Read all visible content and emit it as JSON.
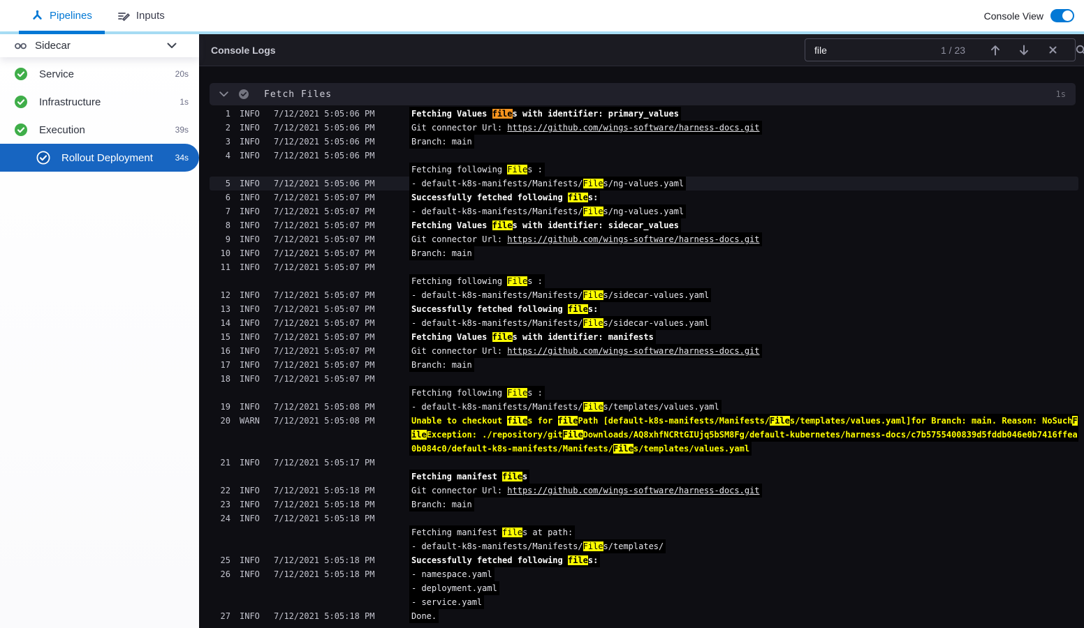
{
  "topbar": {
    "tabs": [
      {
        "label": "Pipelines",
        "active": true
      },
      {
        "label": "Inputs",
        "active": false
      }
    ],
    "console_view_label": "Console View",
    "console_view_on": true
  },
  "sidebar": {
    "pipeline": {
      "name": "Sidecar"
    },
    "steps": [
      {
        "label": "Service",
        "duration": "20s",
        "status": "success",
        "selected": false,
        "indent": 0
      },
      {
        "label": "Infrastructure",
        "duration": "1s",
        "status": "success",
        "selected": false,
        "indent": 0
      },
      {
        "label": "Execution",
        "duration": "39s",
        "status": "success",
        "selected": false,
        "indent": 0
      },
      {
        "label": "Rollout Deployment",
        "duration": "34s",
        "status": "success",
        "selected": true,
        "indent": 1
      }
    ]
  },
  "console": {
    "title": "Console Logs",
    "search": {
      "value": "file",
      "match_counter": "1 / 23"
    },
    "section": {
      "title": "Fetch Files",
      "duration": "1s",
      "status": "success"
    },
    "colors": {
      "accent_blue": "#0278d5",
      "selected_step_blue": "#1765c1",
      "success_green": "#3fae49",
      "highlight_yellow": "#ffff00",
      "highlight_current_orange": "#f7941e",
      "warn_text_yellow": "#ffff00",
      "cyan_strip": "#a8def5"
    },
    "log_lines": [
      {
        "num": 1,
        "level": "INFO",
        "time": "7/12/2021 5:05:06 PM",
        "style": "bold",
        "rows": [
          [
            {
              "t": "Fetching Values "
            },
            {
              "t": "file",
              "h": "current"
            },
            {
              "t": "s with identifier: primary_values"
            }
          ]
        ]
      },
      {
        "num": 2,
        "level": "INFO",
        "time": "7/12/2021 5:05:06 PM",
        "style": "plain",
        "rows": [
          [
            {
              "t": "Git connector Url: "
            },
            {
              "t": "https://github.com/wings-software/harness-docs.git",
              "url": true
            }
          ]
        ]
      },
      {
        "num": 3,
        "level": "INFO",
        "time": "7/12/2021 5:05:06 PM",
        "style": "plain",
        "rows": [
          [
            {
              "t": "Branch: main"
            }
          ]
        ]
      },
      {
        "num": 4,
        "level": "INFO",
        "time": "7/12/2021 5:05:06 PM",
        "style": "plain",
        "rows": [
          [],
          [
            {
              "t": "Fetching following "
            },
            {
              "t": "File",
              "h": "match"
            },
            {
              "t": "s :"
            }
          ]
        ]
      },
      {
        "num": 5,
        "level": "INFO",
        "time": "7/12/2021 5:05:06 PM",
        "style": "plain",
        "current_row": true,
        "rows": [
          [
            {
              "t": "- default-k8s-manifests/Manifests/"
            },
            {
              "t": "File",
              "h": "match"
            },
            {
              "t": "s/ng-values.yaml"
            }
          ]
        ]
      },
      {
        "num": 6,
        "level": "INFO",
        "time": "7/12/2021 5:05:07 PM",
        "style": "bold",
        "rows": [
          [
            {
              "t": "Successfully fetched following "
            },
            {
              "t": "file",
              "h": "match"
            },
            {
              "t": "s:"
            }
          ]
        ]
      },
      {
        "num": 7,
        "level": "INFO",
        "time": "7/12/2021 5:05:07 PM",
        "style": "plain",
        "rows": [
          [
            {
              "t": "- default-k8s-manifests/Manifests/"
            },
            {
              "t": "File",
              "h": "match"
            },
            {
              "t": "s/ng-values.yaml"
            }
          ]
        ]
      },
      {
        "num": 8,
        "level": "INFO",
        "time": "7/12/2021 5:05:07 PM",
        "style": "bold",
        "rows": [
          [
            {
              "t": "Fetching Values "
            },
            {
              "t": "file",
              "h": "match"
            },
            {
              "t": "s with identifier: sidecar_values"
            }
          ]
        ]
      },
      {
        "num": 9,
        "level": "INFO",
        "time": "7/12/2021 5:05:07 PM",
        "style": "plain",
        "rows": [
          [
            {
              "t": "Git connector Url: "
            },
            {
              "t": "https://github.com/wings-software/harness-docs.git",
              "url": true
            }
          ]
        ]
      },
      {
        "num": 10,
        "level": "INFO",
        "time": "7/12/2021 5:05:07 PM",
        "style": "plain",
        "rows": [
          [
            {
              "t": "Branch: main"
            }
          ]
        ]
      },
      {
        "num": 11,
        "level": "INFO",
        "time": "7/12/2021 5:05:07 PM",
        "style": "plain",
        "rows": [
          [],
          [
            {
              "t": "Fetching following "
            },
            {
              "t": "File",
              "h": "match"
            },
            {
              "t": "s :"
            }
          ]
        ]
      },
      {
        "num": 12,
        "level": "INFO",
        "time": "7/12/2021 5:05:07 PM",
        "style": "plain",
        "rows": [
          [
            {
              "t": "- default-k8s-manifests/Manifests/"
            },
            {
              "t": "File",
              "h": "match"
            },
            {
              "t": "s/sidecar-values.yaml"
            }
          ]
        ]
      },
      {
        "num": 13,
        "level": "INFO",
        "time": "7/12/2021 5:05:07 PM",
        "style": "bold",
        "rows": [
          [
            {
              "t": "Successfully fetched following "
            },
            {
              "t": "file",
              "h": "match"
            },
            {
              "t": "s:"
            }
          ]
        ]
      },
      {
        "num": 14,
        "level": "INFO",
        "time": "7/12/2021 5:05:07 PM",
        "style": "plain",
        "rows": [
          [
            {
              "t": "- default-k8s-manifests/Manifests/"
            },
            {
              "t": "File",
              "h": "match"
            },
            {
              "t": "s/sidecar-values.yaml"
            }
          ]
        ]
      },
      {
        "num": 15,
        "level": "INFO",
        "time": "7/12/2021 5:05:07 PM",
        "style": "bold",
        "rows": [
          [
            {
              "t": "Fetching Values "
            },
            {
              "t": "file",
              "h": "match"
            },
            {
              "t": "s with identifier: manifests"
            }
          ]
        ]
      },
      {
        "num": 16,
        "level": "INFO",
        "time": "7/12/2021 5:05:07 PM",
        "style": "plain",
        "rows": [
          [
            {
              "t": "Git connector Url: "
            },
            {
              "t": "https://github.com/wings-software/harness-docs.git",
              "url": true
            }
          ]
        ]
      },
      {
        "num": 17,
        "level": "INFO",
        "time": "7/12/2021 5:05:07 PM",
        "style": "plain",
        "rows": [
          [
            {
              "t": "Branch: main"
            }
          ]
        ]
      },
      {
        "num": 18,
        "level": "INFO",
        "time": "7/12/2021 5:05:07 PM",
        "style": "plain",
        "rows": [
          [],
          [
            {
              "t": "Fetching following "
            },
            {
              "t": "File",
              "h": "match"
            },
            {
              "t": "s :"
            }
          ]
        ]
      },
      {
        "num": 19,
        "level": "INFO",
        "time": "7/12/2021 5:05:08 PM",
        "style": "plain",
        "rows": [
          [
            {
              "t": "- default-k8s-manifests/Manifests/"
            },
            {
              "t": "File",
              "h": "match"
            },
            {
              "t": "s/templates/values.yaml"
            }
          ]
        ]
      },
      {
        "num": 20,
        "level": "WARN",
        "time": "7/12/2021 5:05:08 PM",
        "style": "warn",
        "rows": [
          [
            {
              "t": "Unable to checkout "
            },
            {
              "t": "file",
              "h": "match"
            },
            {
              "t": "s for "
            },
            {
              "t": "file",
              "h": "match"
            },
            {
              "t": "Path [default-k8s-manifests/Manifests/"
            },
            {
              "t": "File",
              "h": "match"
            },
            {
              "t": "s/templates/values.yaml]for Branch: main. Reason: NoSuch"
            },
            {
              "t": "F",
              "h": "match"
            }
          ],
          [
            {
              "t": "ile",
              "h": "match"
            },
            {
              "t": "Exception: ./repository/git"
            },
            {
              "t": "File",
              "h": "match"
            },
            {
              "t": "Downloads/AQ8xhfNCRtGIUjq5bSM8Fg/default-kubernetes/harness-docs/c7b5755400839d5fddb046e0b7416ffea"
            }
          ],
          [
            {
              "t": "0b084c0/default-k8s-manifests/Manifests/"
            },
            {
              "t": "File",
              "h": "match"
            },
            {
              "t": "s/templates/values.yaml"
            }
          ]
        ]
      },
      {
        "num": 21,
        "level": "INFO",
        "time": "7/12/2021 5:05:17 PM",
        "style": "bold",
        "rows": [
          [],
          [
            {
              "t": "Fetching manifest "
            },
            {
              "t": "file",
              "h": "match"
            },
            {
              "t": "s"
            }
          ]
        ]
      },
      {
        "num": 22,
        "level": "INFO",
        "time": "7/12/2021 5:05:18 PM",
        "style": "plain",
        "rows": [
          [
            {
              "t": "Git connector Url: "
            },
            {
              "t": "https://github.com/wings-software/harness-docs.git",
              "url": true
            }
          ]
        ]
      },
      {
        "num": 23,
        "level": "INFO",
        "time": "7/12/2021 5:05:18 PM",
        "style": "plain",
        "rows": [
          [
            {
              "t": "Branch: main"
            }
          ]
        ]
      },
      {
        "num": 24,
        "level": "INFO",
        "time": "7/12/2021 5:05:18 PM",
        "style": "plain",
        "rows": [
          [],
          [
            {
              "t": "Fetching manifest "
            },
            {
              "t": "file",
              "h": "match"
            },
            {
              "t": "s at path:"
            }
          ],
          [
            {
              "t": "- default-k8s-manifests/Manifests/"
            },
            {
              "t": "File",
              "h": "match"
            },
            {
              "t": "s/templates/"
            }
          ]
        ]
      },
      {
        "num": 25,
        "level": "INFO",
        "time": "7/12/2021 5:05:18 PM",
        "style": "bold",
        "rows": [
          [
            {
              "t": "Successfully fetched following "
            },
            {
              "t": "file",
              "h": "match"
            },
            {
              "t": "s:"
            }
          ]
        ]
      },
      {
        "num": 26,
        "level": "INFO",
        "time": "7/12/2021 5:05:18 PM",
        "style": "plain",
        "rows": [
          [
            {
              "t": "- namespace.yaml"
            }
          ],
          [
            {
              "t": "- deployment.yaml"
            }
          ],
          [
            {
              "t": "- service.yaml"
            }
          ]
        ]
      },
      {
        "num": 27,
        "level": "INFO",
        "time": "7/12/2021 5:05:18 PM",
        "style": "plain",
        "rows": [
          [
            {
              "t": "Done."
            }
          ]
        ]
      }
    ]
  }
}
